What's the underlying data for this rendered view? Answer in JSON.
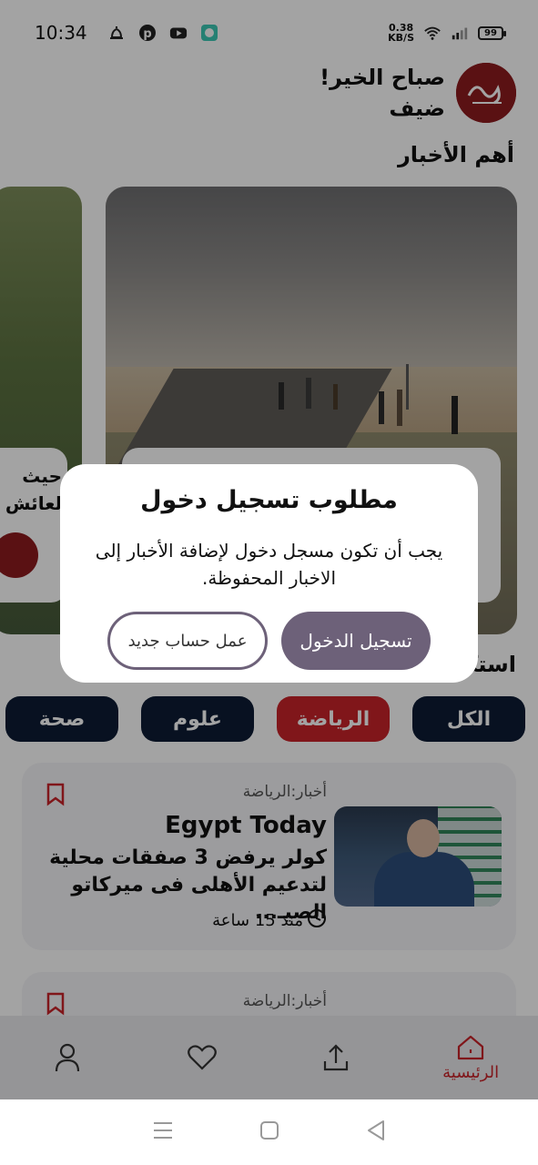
{
  "status_bar": {
    "time": "10:34",
    "net_speed_value": "0.38",
    "net_speed_unit": "KB/S",
    "battery": "99"
  },
  "header": {
    "greeting": "صباح الخير!",
    "username": "ضيف"
  },
  "top_news": {
    "title": "أهم الأخبار",
    "side_card_text": "حيث لعائش"
  },
  "categories_heading": "استكشف",
  "categories": [
    {
      "label": "الكل",
      "active": false
    },
    {
      "label": "الرياضة",
      "active": true
    },
    {
      "label": "علوم",
      "active": false
    },
    {
      "label": "صحة",
      "active": false
    }
  ],
  "articles": [
    {
      "category": "أخبار:الرياضة",
      "source": "Egypt Today",
      "title": "كولر يرفض 3 صفقات محلية لتدعيم الأهلى فى ميركاتو الصيـ...",
      "time": "منذ 15 ساعة"
    },
    {
      "category": "أخبار:الرياضة"
    }
  ],
  "bottom_nav": {
    "home_label": "الرئيسية"
  },
  "dialog": {
    "title": "مطلوب تسجيل دخول",
    "body": "يجب أن تكون مسجل دخول لإضافة الأخبار إلى الاخبار المحفوظة.",
    "login_label": "تسجيل الدخول",
    "register_label": "عمل حساب جديد"
  },
  "colors": {
    "accent": "#c8232a",
    "navy": "#0d1b34",
    "dialog_button": "#6d6179"
  },
  "icons": [
    "mute-icon",
    "pinterest-icon",
    "youtube-icon",
    "chat-icon",
    "wifi-icon",
    "signal-icon",
    "battery-icon",
    "bookmark-icon",
    "clock-icon",
    "user-icon",
    "heart-icon",
    "share-icon",
    "home-icon",
    "menu-icon",
    "square-icon",
    "back-icon"
  ]
}
